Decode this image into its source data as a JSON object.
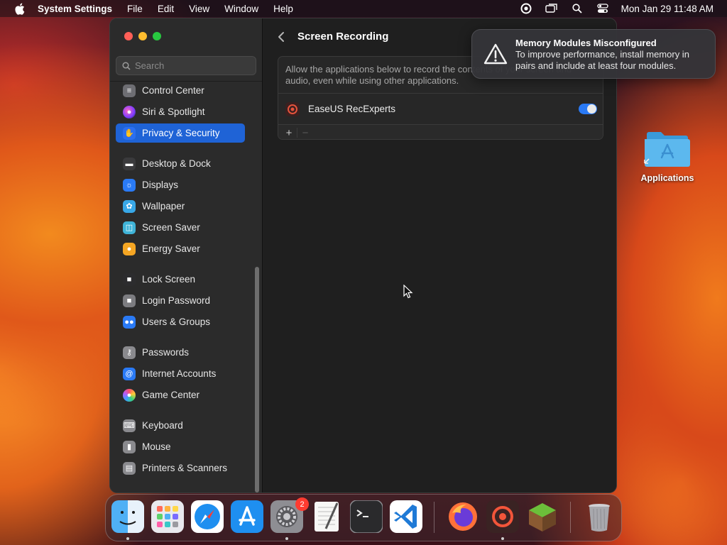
{
  "menubar": {
    "app_name": "System Settings",
    "menus": [
      "File",
      "Edit",
      "View",
      "Window",
      "Help"
    ],
    "clock": "Mon Jan 29  11:48 AM"
  },
  "sidebar": {
    "search_placeholder": "Search",
    "items": [
      {
        "label": "Control Center",
        "icon": "control-center-icon",
        "color": "#6e6e73"
      },
      {
        "label": "Siri & Spotlight",
        "icon": "siri-icon",
        "color": "#b02bd9"
      },
      {
        "label": "Privacy & Security",
        "icon": "hand-icon",
        "color": "#2b6ff0",
        "selected": true
      },
      {
        "label": "Desktop & Dock",
        "icon": "dock-icon",
        "color": "#3a3a3c"
      },
      {
        "label": "Displays",
        "icon": "sun-icon",
        "color": "#2a7af5"
      },
      {
        "label": "Wallpaper",
        "icon": "flower-icon",
        "color": "#38a8e8"
      },
      {
        "label": "Screen Saver",
        "icon": "screensaver-icon",
        "color": "#3fb4d8"
      },
      {
        "label": "Energy Saver",
        "icon": "bulb-icon",
        "color": "#f5a623"
      },
      {
        "label": "Lock Screen",
        "icon": "lock-icon",
        "color": "#2c2c2e"
      },
      {
        "label": "Login Password",
        "icon": "padlock-icon",
        "color": "#7c7c80"
      },
      {
        "label": "Users & Groups",
        "icon": "users-icon",
        "color": "#2a7af5"
      },
      {
        "label": "Passwords",
        "icon": "key-icon",
        "color": "#8a8a8e"
      },
      {
        "label": "Internet Accounts",
        "icon": "at-icon",
        "color": "#2a7af5"
      },
      {
        "label": "Game Center",
        "icon": "game-center-icon",
        "color": "#e8e8e8"
      },
      {
        "label": "Keyboard",
        "icon": "keyboard-icon",
        "color": "#8a8a8e"
      },
      {
        "label": "Mouse",
        "icon": "mouse-icon",
        "color": "#8a8a8e"
      },
      {
        "label": "Printers & Scanners",
        "icon": "printer-icon",
        "color": "#8a8a8e"
      }
    ]
  },
  "content": {
    "title": "Screen Recording",
    "description": "Allow the applications below to record the contents of your screen and audio, even while using other applications.",
    "apps": [
      {
        "name": "EaseUS RecExperts",
        "enabled": true
      }
    ],
    "add_label": "+",
    "remove_label": "−"
  },
  "notification": {
    "title": "Memory Modules Misconfigured",
    "body": "To improve performance, install memory in pairs and include at least four modules."
  },
  "desktop": {
    "icon_label": "Applications"
  },
  "dock": {
    "items": [
      {
        "name": "Finder",
        "icon": "finder-icon",
        "running": true
      },
      {
        "name": "Launchpad",
        "icon": "launchpad-icon"
      },
      {
        "name": "Safari",
        "icon": "safari-icon"
      },
      {
        "name": "App Store",
        "icon": "app-store-icon"
      },
      {
        "name": "System Settings",
        "icon": "system-settings-icon",
        "running": true,
        "badge": "2"
      },
      {
        "name": "TextEdit",
        "icon": "textedit-icon"
      },
      {
        "name": "Terminal",
        "icon": "terminal-icon"
      },
      {
        "name": "Visual Studio Code",
        "icon": "vscode-icon"
      },
      {
        "name": "Firefox",
        "icon": "firefox-icon"
      },
      {
        "name": "EaseUS RecExperts",
        "icon": "recexperts-icon",
        "running": true
      },
      {
        "name": "Minecraft",
        "icon": "minecraft-icon"
      },
      {
        "name": "Trash",
        "icon": "trash-icon"
      }
    ]
  }
}
